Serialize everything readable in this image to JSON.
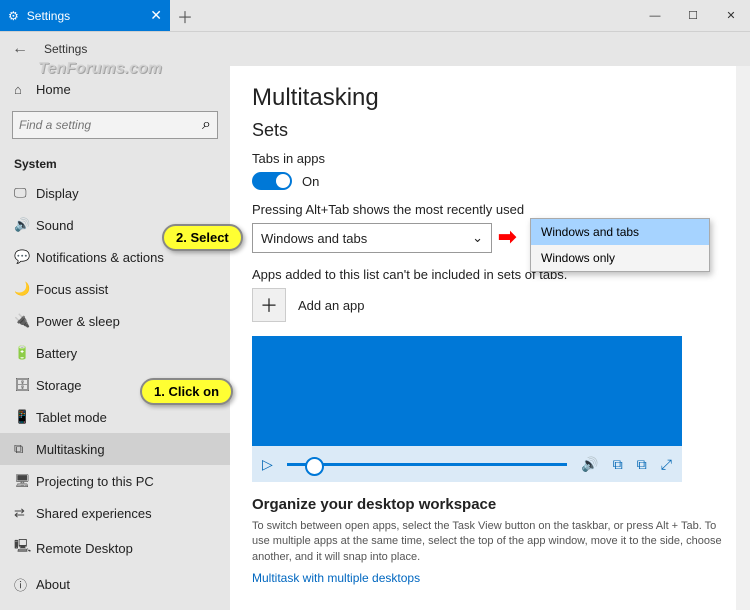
{
  "titlebar": {
    "tab_title": "Settings",
    "close": "✕",
    "newtab": "＋",
    "minimize": "—",
    "maximize": "☐",
    "win_close": "✕"
  },
  "header": {
    "back": "←",
    "title": "Settings"
  },
  "search": {
    "placeholder": "Find a setting",
    "icon": "⌕"
  },
  "sidebar": {
    "home": "Home",
    "section": "System",
    "items": [
      {
        "icon": "🖵",
        "label": "Display"
      },
      {
        "icon": "🔊",
        "label": "Sound"
      },
      {
        "icon": "💬",
        "label": "Notifications & actions"
      },
      {
        "icon": "🌙",
        "label": "Focus assist"
      },
      {
        "icon": "🔌",
        "label": "Power & sleep"
      },
      {
        "icon": "🔋",
        "label": "Battery"
      },
      {
        "icon": "🗄",
        "label": "Storage"
      },
      {
        "icon": "📱",
        "label": "Tablet mode"
      },
      {
        "icon": "⧉",
        "label": "Multitasking"
      },
      {
        "icon": "🖥",
        "label": "Projecting to this PC"
      },
      {
        "icon": "⇄",
        "label": "Shared experiences"
      },
      {
        "icon": "🖳",
        "label": "Remote Desktop"
      },
      {
        "icon": "ⓘ",
        "label": "About"
      }
    ]
  },
  "content": {
    "h1": "Multitasking",
    "h2": "Sets",
    "tabs_label": "Tabs in apps",
    "toggle_state": "On",
    "alttab_label": "Pressing Alt+Tab shows the most recently used",
    "dropdown_value": "Windows and tabs",
    "dropdown_chevron": "⌄",
    "apps_hint": "Apps added to this list can't be included in sets of tabs.",
    "add_app": "Add an app",
    "plus": "＋",
    "play": "▷",
    "sound": "🔊",
    "cc": "⧉",
    "cast": "⧉",
    "fullscreen": "⤢",
    "organize_h": "Organize your desktop workspace",
    "organize_desc": "To switch between open apps, select the Task View button on the taskbar, or press Alt + Tab. To use multiple apps at the same time, select the top of the app window, move it to the side, choose another, and it will snap into place.",
    "link": "Multitask with multiple desktops"
  },
  "popup": {
    "opt1": "Windows and tabs",
    "opt2": "Windows only"
  },
  "callouts": {
    "c1": "1. Click on",
    "c2": "2. Select",
    "arrow": "➡"
  },
  "watermark": "TenForums.com"
}
